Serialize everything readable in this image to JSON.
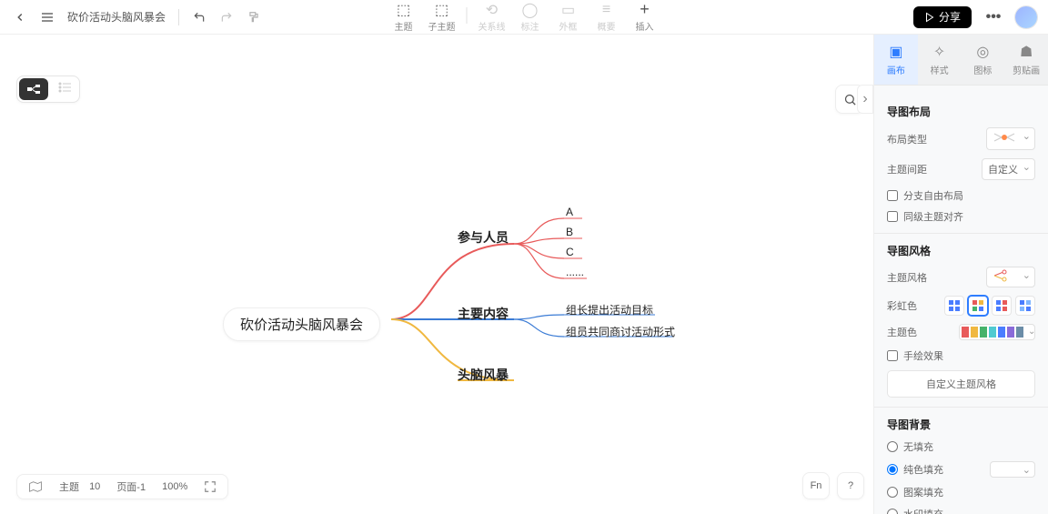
{
  "doc_title": "砍价活动头脑风暴会",
  "toolbar": {
    "topic": "主题",
    "subtopic": "子主题",
    "relation": "关系线",
    "note": "标注",
    "frame": "外框",
    "summary": "概要",
    "insert": "插入"
  },
  "share_label": "分享",
  "side_tabs": {
    "canvas": "画布",
    "format": "样式",
    "icons": "图标",
    "clipboard": "剪贴画"
  },
  "panel": {
    "section_layout": "导图布局",
    "layout_type": "布局类型",
    "topic_spacing": "主题间距",
    "spacing_value": "自定义",
    "free_branch": "分支自由布局",
    "sibling_align": "同级主题对齐",
    "section_style": "导图风格",
    "theme_style": "主题风格",
    "rainbow": "彩虹色",
    "theme_color": "主题色",
    "hand_drawn": "手绘效果",
    "custom_style": "自定义主题风格",
    "section_bg": "导图背景",
    "bg_none": "无填充",
    "bg_solid": "纯色填充",
    "bg_pattern": "图案填充",
    "bg_watermark": "水印填充"
  },
  "status": {
    "topics_label": "主题",
    "topics_count": 10,
    "page_label": "页面-1",
    "zoom": "100%"
  },
  "mindmap": {
    "root": "砍价活动头脑风暴会",
    "branches": [
      {
        "label": "参与人员",
        "children": [
          "A",
          "B",
          "C",
          "......"
        ]
      },
      {
        "label": "主要内容",
        "children": [
          "组长提出活动目标",
          "组员共同商讨活动形式"
        ]
      },
      {
        "label": "头脑风暴",
        "children": []
      }
    ]
  },
  "chart_data": {
    "type": "mindmap",
    "title": "砍价活动头脑风暴会",
    "root": "砍价活动头脑风暴会",
    "nodes": [
      {
        "id": "root",
        "label": "砍价活动头脑风暴会",
        "parent": null
      },
      {
        "id": "b1",
        "label": "参与人员",
        "parent": "root",
        "color": "#e85a5a"
      },
      {
        "id": "b1a",
        "label": "A",
        "parent": "b1"
      },
      {
        "id": "b1b",
        "label": "B",
        "parent": "b1"
      },
      {
        "id": "b1c",
        "label": "C",
        "parent": "b1"
      },
      {
        "id": "b1d",
        "label": "......",
        "parent": "b1"
      },
      {
        "id": "b2",
        "label": "主要内容",
        "parent": "root",
        "color": "#3a7bd5"
      },
      {
        "id": "b2a",
        "label": "组长提出活动目标",
        "parent": "b2"
      },
      {
        "id": "b2b",
        "label": "组员共同商讨活动形式",
        "parent": "b2"
      },
      {
        "id": "b3",
        "label": "头脑风暴",
        "parent": "root",
        "color": "#f0b840"
      }
    ]
  }
}
